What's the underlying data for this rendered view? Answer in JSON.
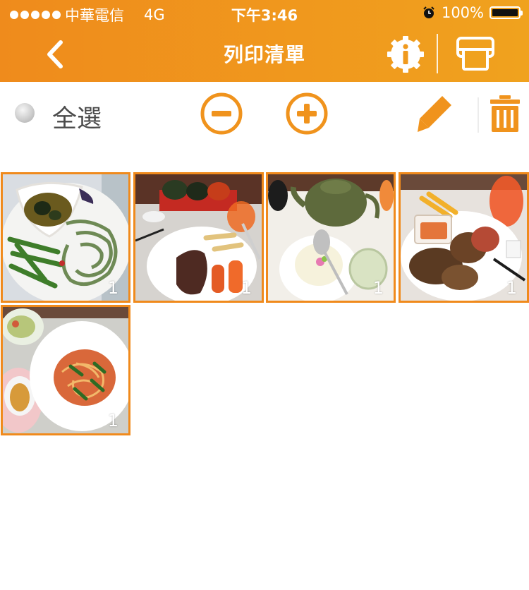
{
  "status": {
    "carrier": "中華電信",
    "network": "4G",
    "time": "下午3:46",
    "battery": "100%",
    "battery_level": 1.0
  },
  "header": {
    "title": "列印清單",
    "back_icon": "chevron-left-icon",
    "info_icon": "info-gear-icon",
    "print_icon": "printer-icon"
  },
  "toolbar": {
    "select_all_label": "全選",
    "decrease_icon": "minus-circle-icon",
    "increase_icon": "plus-circle-icon",
    "edit_icon": "pencil-icon",
    "delete_icon": "trash-icon"
  },
  "photos": [
    {
      "count": "1",
      "subject": "pasta-vegetables"
    },
    {
      "count": "1",
      "subject": "steak-sushi"
    },
    {
      "count": "1",
      "subject": "teapot-dessert"
    },
    {
      "count": "1",
      "subject": "grilled-chicken"
    },
    {
      "count": "1",
      "subject": "spaghetti-salad"
    }
  ],
  "colors": {
    "accent": "#f0931d",
    "header_start": "#ef8b1c",
    "header_end": "#f0a21e",
    "thumb_border": "#f08a1c"
  }
}
